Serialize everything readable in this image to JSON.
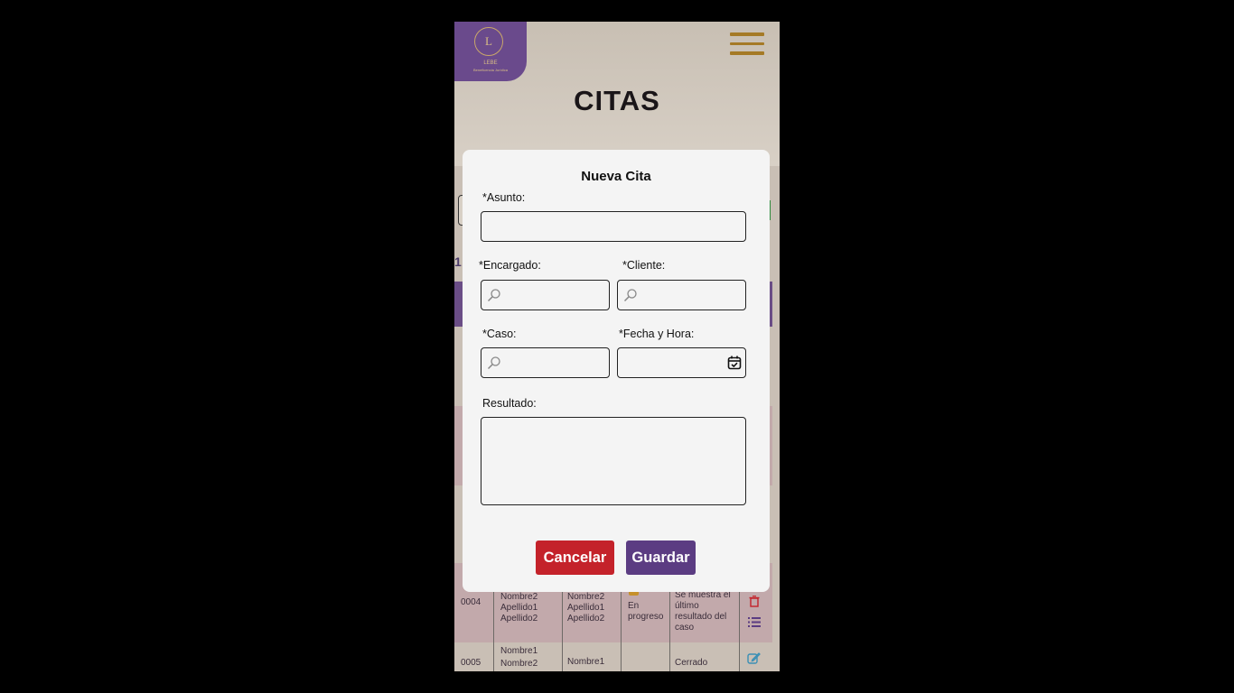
{
  "app": {
    "logo_letter": "L",
    "logo_name": "LEBE",
    "logo_tagline": "Beneficencia Jurídica",
    "page_title": "CITAS",
    "page_indicator": "1"
  },
  "background_table": {
    "rows": [
      {
        "id": "0004",
        "encargado": [
          "Nombre2",
          "Apellido1",
          "Apellido2"
        ],
        "cliente": [
          "Nombre2",
          "Apellido1",
          "Apellido2"
        ],
        "estado": "En progreso",
        "resultado": "Se muestra el último resultado del caso"
      },
      {
        "id": "0005",
        "encargado": [
          "Nombre1",
          "Nombre2"
        ],
        "cliente": [
          "Nombre1"
        ],
        "estado": "",
        "resultado": "Cerrado"
      }
    ]
  },
  "modal": {
    "title": "Nueva Cita",
    "asunto_label": "*Asunto:",
    "encargado_label": "*Encargado:",
    "cliente_label": "*Cliente:",
    "caso_label": "*Caso:",
    "fecha_label": "*Fecha y Hora:",
    "resultado_label": "Resultado:",
    "asunto_value": "",
    "encargado_value": "",
    "cliente_value": "",
    "caso_value": "",
    "fecha_value": "",
    "resultado_value": "",
    "cancel_label": "Cancelar",
    "save_label": "Guardar"
  },
  "colors": {
    "brand_purple": "#6a4a8c",
    "cancel_red": "#c4222a",
    "save_purple": "#5b3c82",
    "gold": "#a57a26"
  },
  "icons": [
    "hamburger-menu-icon",
    "search-icon",
    "calendar-check-icon",
    "trash-icon",
    "list-icon",
    "edit-icon"
  ]
}
